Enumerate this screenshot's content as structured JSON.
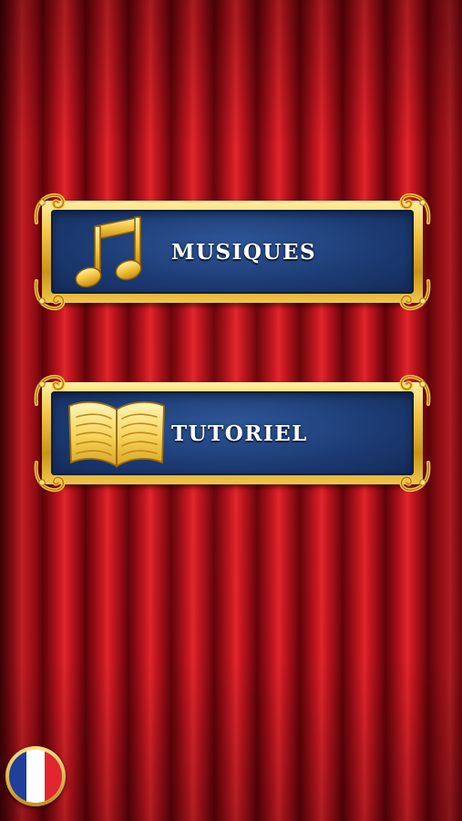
{
  "menu": {
    "items": [
      {
        "label": "MUSIQUES",
        "icon": "music-note-icon"
      },
      {
        "label": "TUTORIEL",
        "icon": "open-book-icon"
      }
    ]
  },
  "language": {
    "icon": "france-flag-icon",
    "colors": [
      "#1f3f9a",
      "#ffffff",
      "#e1262f"
    ]
  },
  "colors": {
    "curtain": "#c3161f",
    "frame_gold": "#f3c64a",
    "panel_blue": "#1d3c75"
  }
}
